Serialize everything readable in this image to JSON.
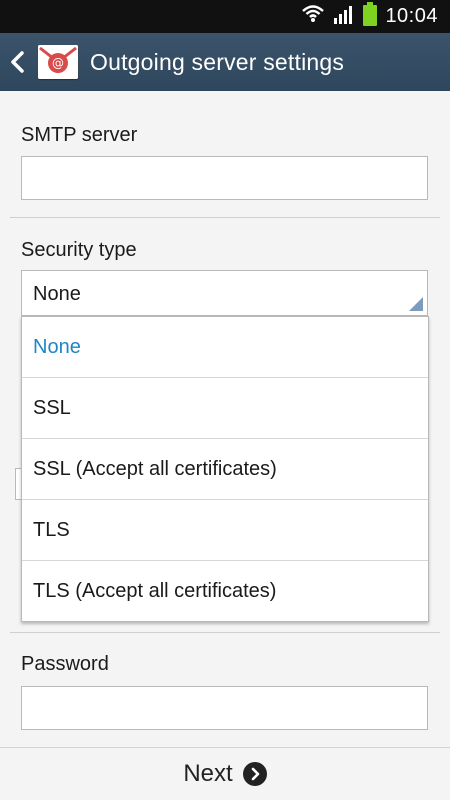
{
  "status_bar": {
    "time": "10:04"
  },
  "app_bar": {
    "title": "Outgoing server settings"
  },
  "form": {
    "smtp_label": "SMTP server",
    "smtp_value": "",
    "security_label": "Security type",
    "security_selected": "None",
    "security_options": [
      "None",
      "SSL",
      "SSL (Accept all certificates)",
      "TLS",
      "TLS (Accept all certificates)"
    ],
    "password_label": "Password",
    "password_value": ""
  },
  "footer": {
    "next_label": "Next"
  },
  "colors": {
    "accent": "#1f86c6",
    "action_bar": "#34495e"
  }
}
